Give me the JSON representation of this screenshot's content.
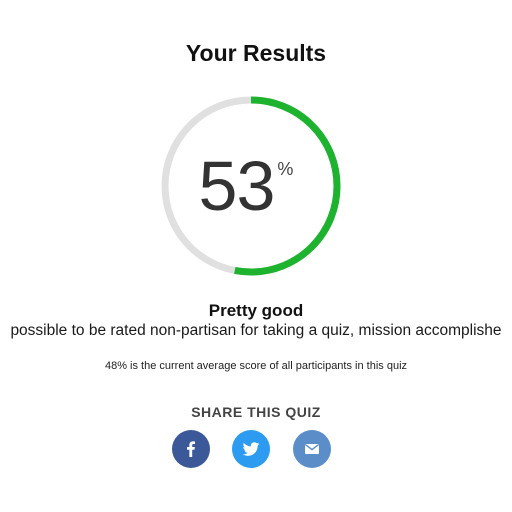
{
  "results": {
    "title": "Your Results",
    "score": 53,
    "score_display": "53",
    "score_unit": "%",
    "score_fraction": 0.53,
    "rating_label": "Pretty good",
    "rating_description": "possible to be rated non-partisan for taking a quiz, mission accomplishe",
    "average_text": "48% is the current average score of all participants in this quiz"
  },
  "colors": {
    "progress": "#1db32f",
    "track": "#e0e0e0",
    "facebook": "#3b5998",
    "twitter": "#2d9cf0",
    "email": "#5b8ec9"
  },
  "share": {
    "heading": "SHARE THIS QUIZ",
    "buttons": [
      {
        "network": "facebook",
        "icon": "facebook-icon"
      },
      {
        "network": "twitter",
        "icon": "twitter-icon"
      },
      {
        "network": "email",
        "icon": "email-icon"
      }
    ]
  }
}
